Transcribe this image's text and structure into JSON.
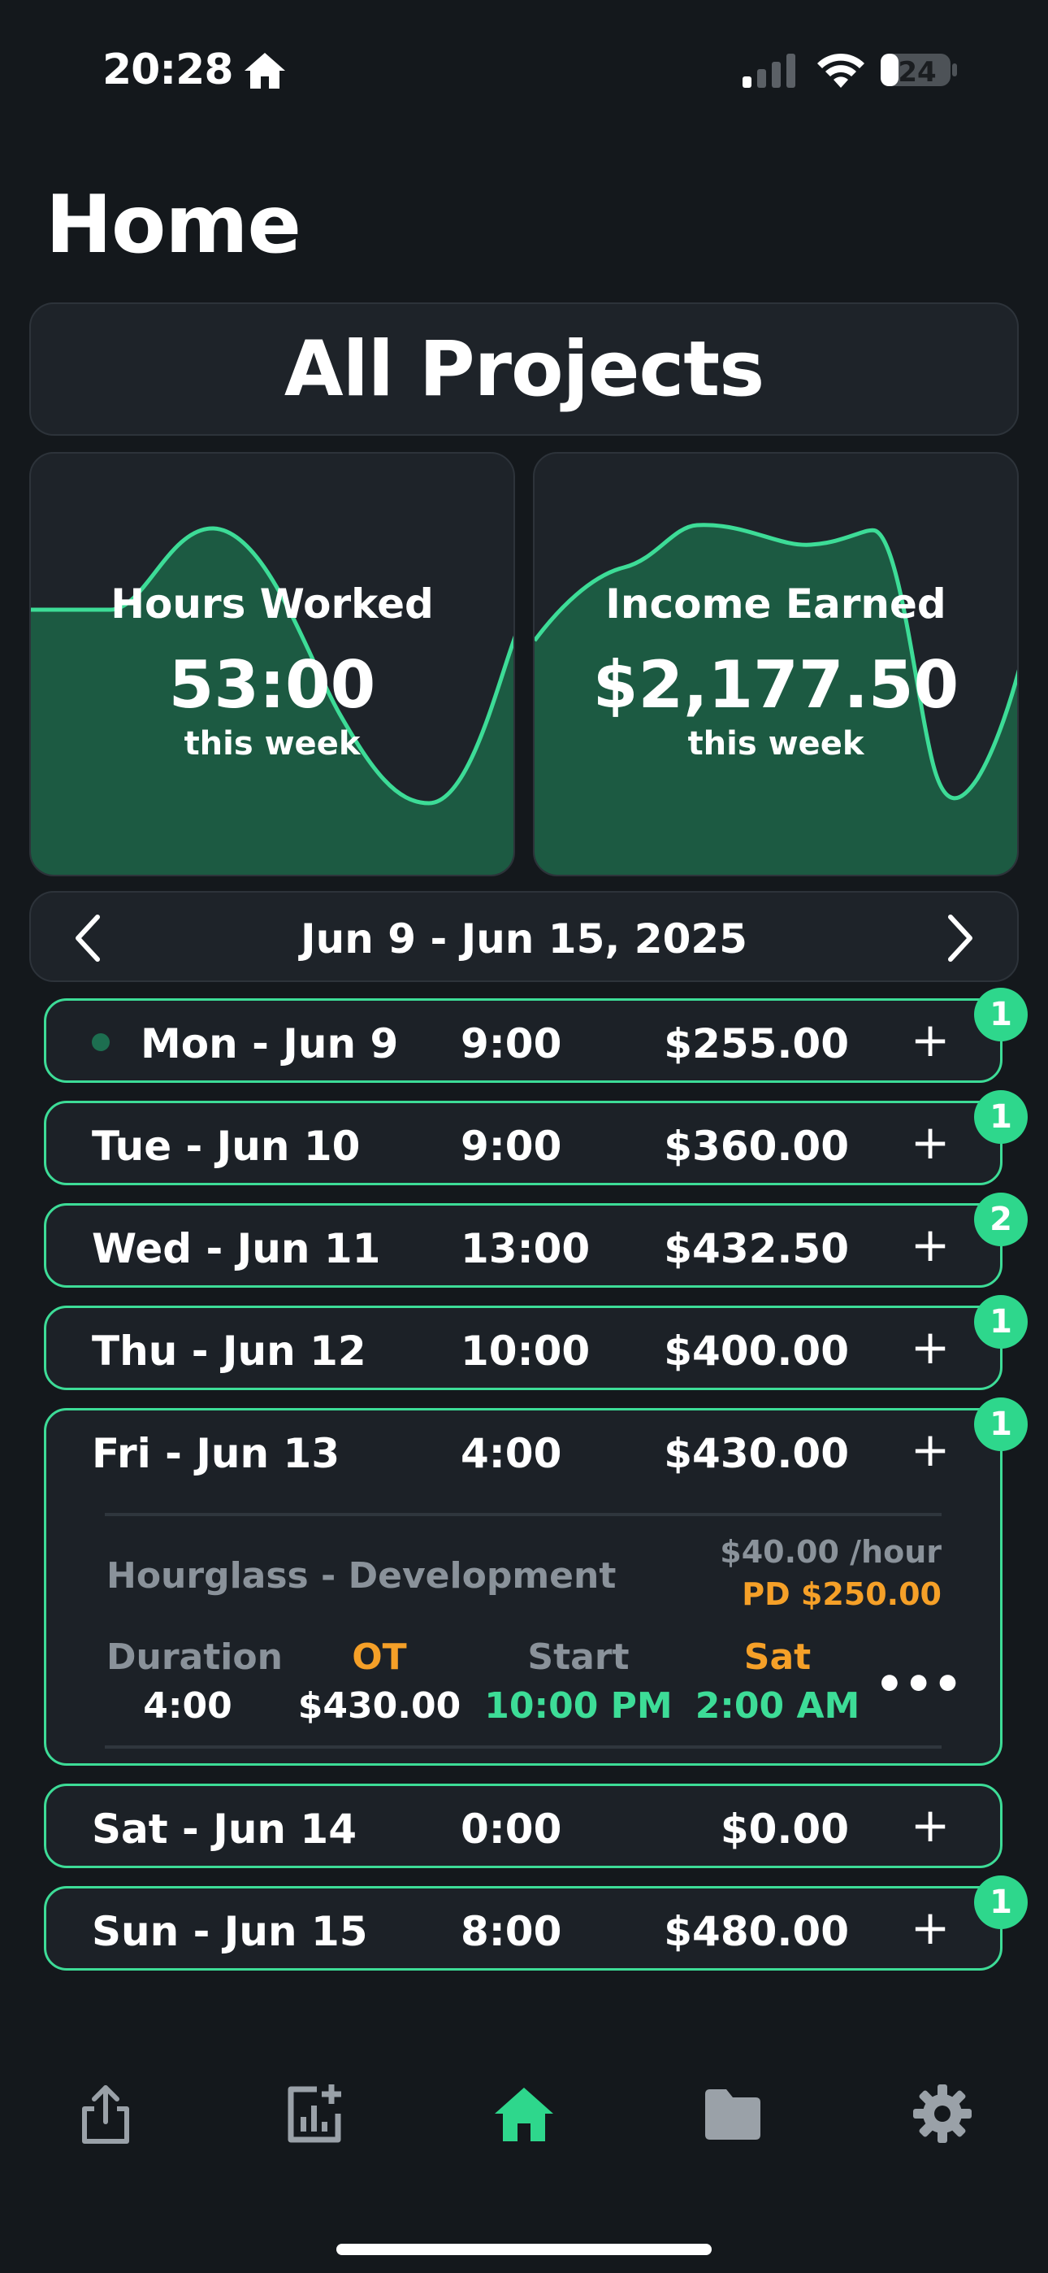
{
  "status_bar": {
    "time": "20:28",
    "battery": "24"
  },
  "page_title": "Home",
  "project_selector": "All Projects",
  "stats": {
    "hours": {
      "label": "Hours Worked",
      "value": "53:00",
      "sub": "this week"
    },
    "income": {
      "label": "Income Earned",
      "value": "$2,177.50",
      "sub": "this week"
    }
  },
  "week": {
    "label": "Jun 9 - Jun 15, 2025"
  },
  "days": [
    {
      "name": "Mon - Jun 9",
      "hours": "9:00",
      "amount": "$255.00",
      "badge": "1",
      "today": true
    },
    {
      "name": "Tue - Jun 10",
      "hours": "9:00",
      "amount": "$360.00",
      "badge": "1"
    },
    {
      "name": "Wed - Jun 11",
      "hours": "13:00",
      "amount": "$432.50",
      "badge": "2"
    },
    {
      "name": "Thu - Jun 12",
      "hours": "10:00",
      "amount": "$400.00",
      "badge": "1"
    },
    {
      "name": "Fri - Jun 13",
      "hours": "4:00",
      "amount": "$430.00",
      "badge": "1",
      "expanded": true
    },
    {
      "name": "Sat - Jun 14",
      "hours": "0:00",
      "amount": "$0.00"
    },
    {
      "name": "Sun - Jun 15",
      "hours": "8:00",
      "amount": "$480.00",
      "badge": "1"
    }
  ],
  "add_label": "+",
  "entry": {
    "project": "Hourglass - Development",
    "rate": "$40.00 /hour",
    "pd": "PD $250.00",
    "duration_label": "Duration",
    "duration_value": "4:00",
    "ot_label": "OT",
    "ot_value": "$430.00",
    "start_label": "Start",
    "start_value": "10:00 PM",
    "end_label": "Sat",
    "end_value": "2:00 AM",
    "more": "•••"
  },
  "colors": {
    "accent": "#3ddc97",
    "badge": "#2ed78c",
    "orange": "#f5a028",
    "muted": "#8a929a",
    "card_bg": "#1e2329",
    "chart_fill": "#1c5a42"
  },
  "tabs": [
    "export-icon",
    "add-chart-icon",
    "home-icon",
    "folder-icon",
    "settings-icon"
  ]
}
